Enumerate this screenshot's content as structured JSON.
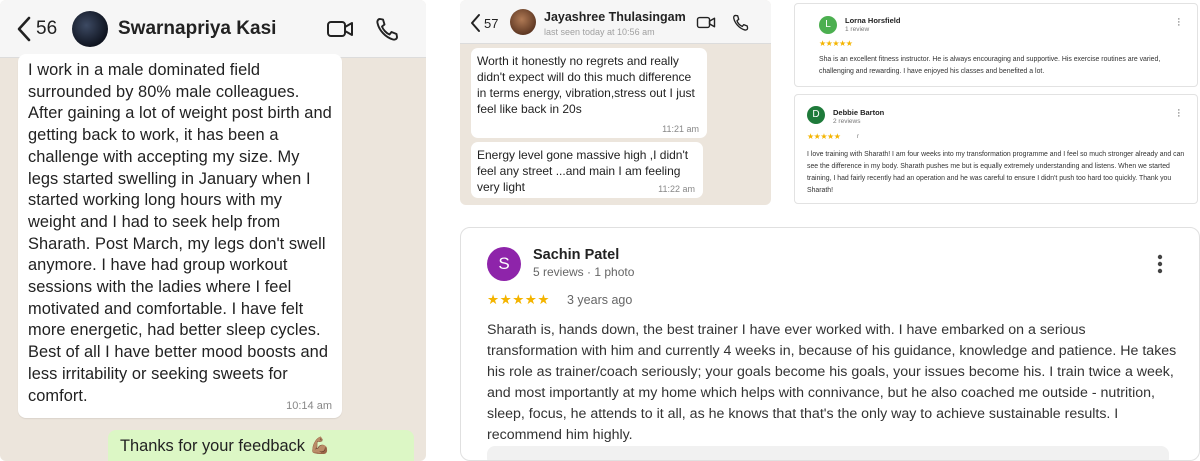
{
  "chat1": {
    "back_count": "56",
    "contact_name": "Swarnapriya Kasi",
    "incoming_message": "I work in a male dominated field surrounded by 80% male colleagues. After gaining a lot of weight post birth and getting back to work, it has been a challenge with accepting my size. My legs started swelling in January when I started working long hours with my weight and I had to seek help from Sharath. Post March, my legs don't swell anymore. I have had group workout sessions with the ladies where I feel motivated and comfortable. I have felt more energetic, had better sleep cycles. Best of all I have better mood boosts and less irritability or seeking sweets for comfort.",
    "incoming_time": "10:14 am",
    "outgoing_message": "Thanks for your feedback 💪🏽"
  },
  "chat2": {
    "back_count": "57",
    "contact_name": "Jayashree Thulasingam",
    "contact_status": "last seen today at 10:56 am",
    "messages": [
      {
        "text": "Worth it honestly no regrets and really didn't expect will do this much difference in terms energy, vibration,stress out I just feel like back in 20s",
        "time": "11:21 am"
      },
      {
        "text": "Energy level gone massive high ,I didn't feel any street ...and main I am feeling very light",
        "time": "11:22 am"
      }
    ]
  },
  "review1": {
    "initial": "L",
    "avatar_color": "#4caf50",
    "name": "Lorna Horsfield",
    "sub": "1 review",
    "stars": "★★★★★",
    "rating": 5,
    "body": "Sha is an excellent fitness instructor. He is always encouraging and supportive. His exercise routines are varied, challenging and rewarding. I have enjoyed his classes and benefited a lot."
  },
  "review2": {
    "initial": "D",
    "avatar_color": "#1e7a3a",
    "name": "Debbie Barton",
    "sub": "2 reviews",
    "stars": "★★★★★",
    "rating": 5,
    "extra": "r",
    "body": "I love training with Sharath! I am four weeks into my transformation programme and I feel so much stronger already and can see the difference in my body. Sharath pushes me but is equally extremely understanding and listens. When we started training, I had fairly recently had an operation and he was careful to ensure I didn't push too hard too quickly. Thank you Sharath!"
  },
  "review3": {
    "initial": "S",
    "avatar_color": "#8e24aa",
    "name": "Sachin Patel",
    "sub": "5 reviews · 1 photo",
    "stars": "★★★★★",
    "rating": 5,
    "date": "3 years ago",
    "body": "Sharath is, hands down, the best trainer I have ever worked with. I have embarked on a serious transformation with him and currently 4 weeks in, because of his guidance, knowledge and patience. He takes his role as trainer/coach seriously; your goals become his goals, your issues become his. I train twice a week, and most importantly at my home which helps with connivance, but he also coached me outside - nutrition, sleep, focus, he attends to it all, as he knows that that's the only way to achieve sustainable results. I recommend him highly."
  },
  "icons": {
    "back": "chevron-left-icon",
    "video": "video-call-icon",
    "phone": "phone-icon",
    "more": "more-vertical-icon",
    "star": "star-icon"
  }
}
